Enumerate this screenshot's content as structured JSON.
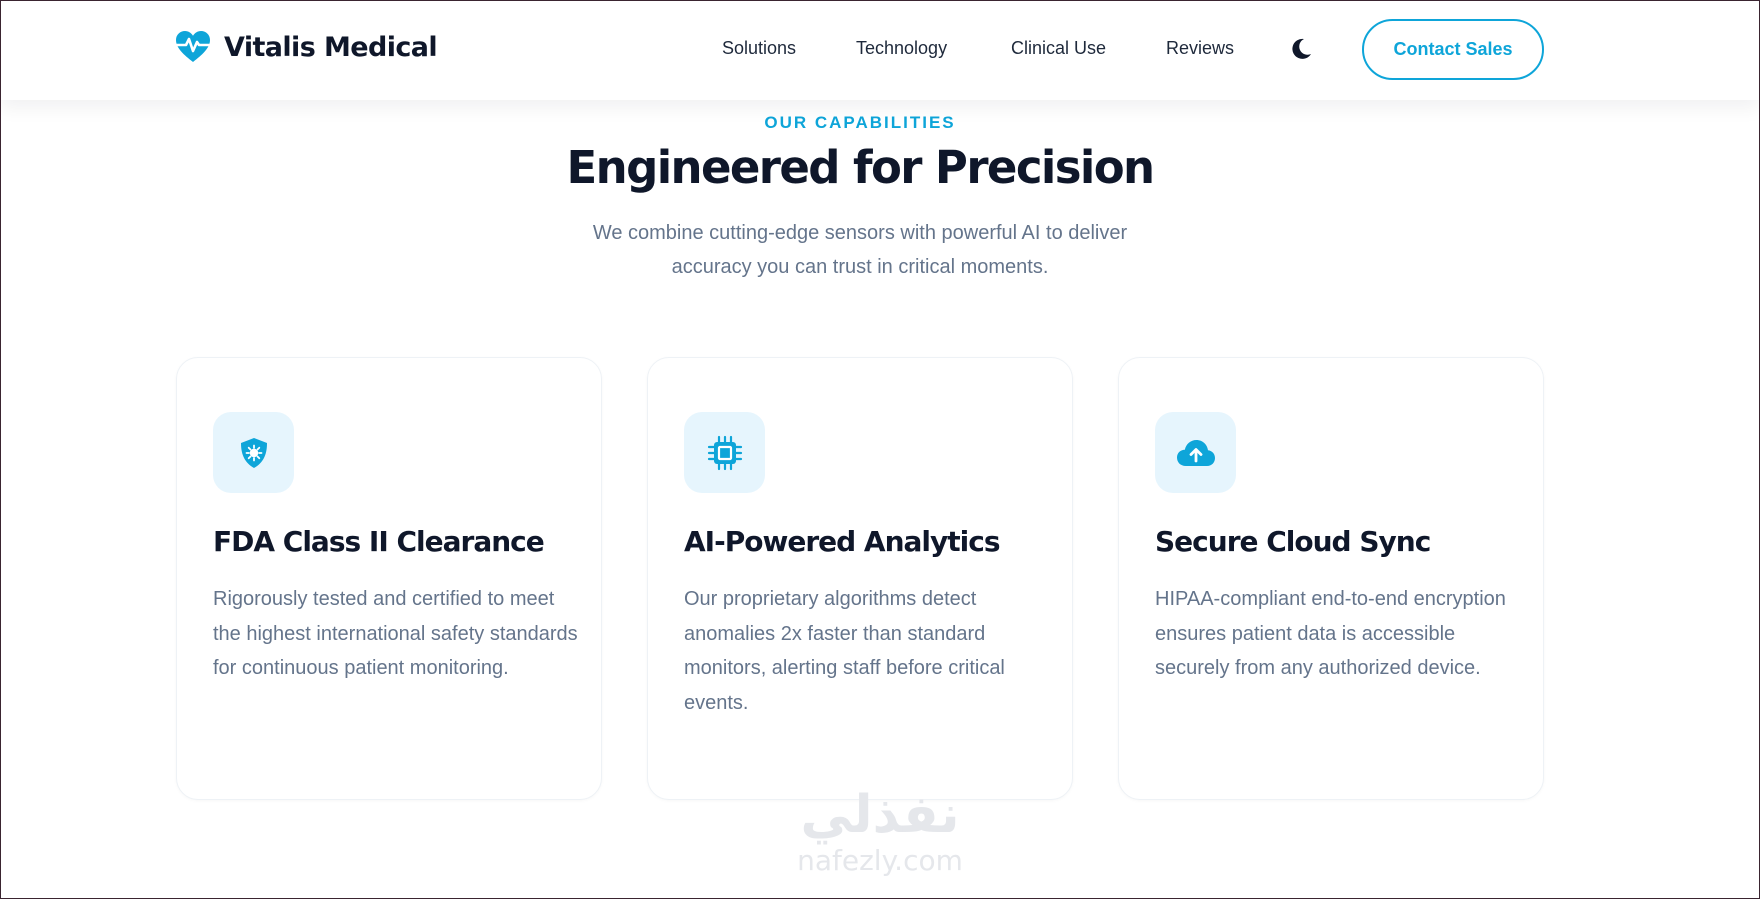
{
  "header": {
    "brand": "Vitalis Medical",
    "brand_icon": "heart-pulse-icon",
    "nav": [
      "Solutions",
      "Technology",
      "Clinical Use",
      "Reviews"
    ],
    "theme_icon": "moon-icon",
    "cta": "Contact Sales"
  },
  "section": {
    "eyebrow": "OUR CAPABILITIES",
    "title": "Engineered for Precision",
    "subtitle": "We combine cutting-edge sensors with powerful AI to deliver accuracy you can trust in critical moments."
  },
  "cards": [
    {
      "icon": "shield-virus-icon",
      "title": "FDA Class II Clearance",
      "text": "Rigorously tested and certified to meet the highest international safety standards for continuous patient monitoring."
    },
    {
      "icon": "microchip-icon",
      "title": "AI-Powered Analytics",
      "text": "Our proprietary algorithms detect anomalies 2x faster than standard monitors, alerting staff before critical events."
    },
    {
      "icon": "cloud-upload-icon",
      "title": "Secure Cloud Sync",
      "text": "HIPAA-compliant end-to-end encryption ensures patient data is accessible securely from any authorized device."
    }
  ],
  "watermark": {
    "arabic": "نفذلي",
    "latin": "nafezly.com"
  },
  "colors": {
    "accent": "#0ea5d9",
    "heading": "#0f172a",
    "body_text": "#64748b",
    "icon_bg": "#e6f5fd"
  }
}
